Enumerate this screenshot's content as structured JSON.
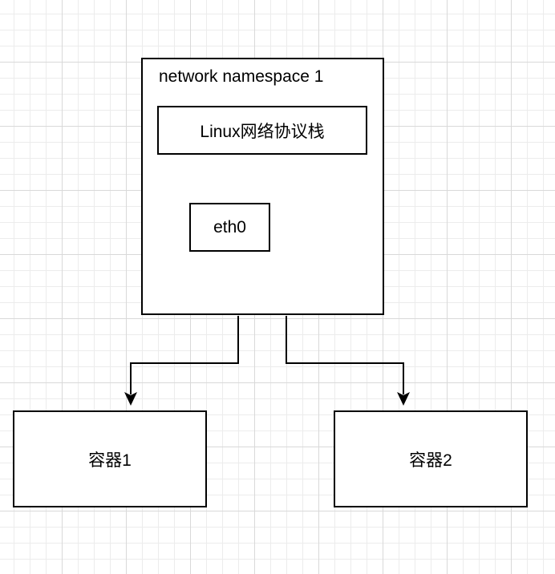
{
  "namespace": {
    "title": "network namespace 1"
  },
  "stack": {
    "label": "Linux网络协议栈"
  },
  "interface": {
    "label": "eth0"
  },
  "containers": [
    {
      "label": "容器1"
    },
    {
      "label": "容器2"
    }
  ],
  "colors": {
    "stroke": "#000000",
    "background": "#ffffff",
    "grid_minor": "#ececec",
    "grid_major": "#d9d9d9"
  }
}
